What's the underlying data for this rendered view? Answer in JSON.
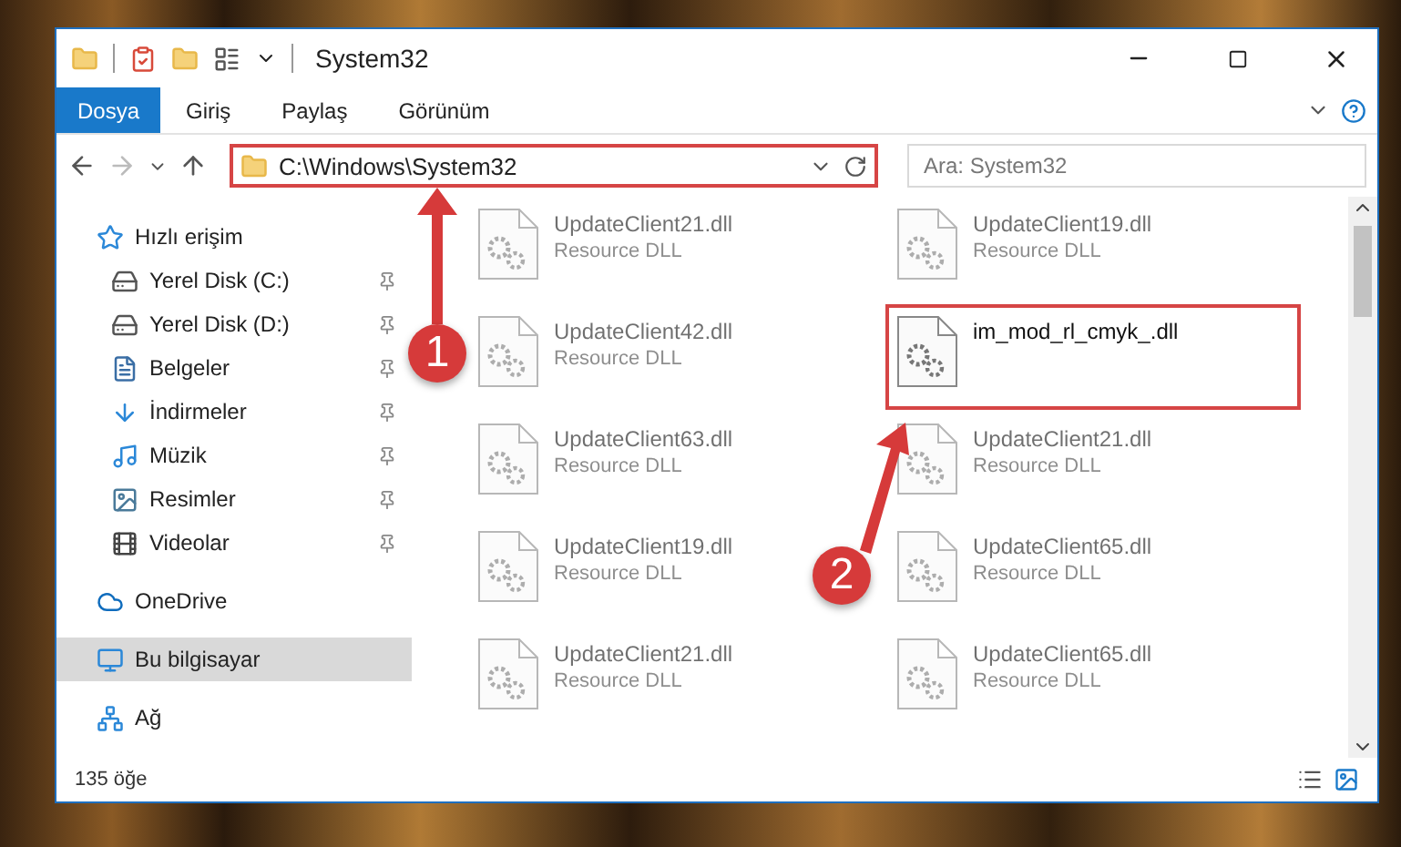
{
  "window": {
    "title": "System32"
  },
  "ribbon": {
    "file_button": "Dosya",
    "tabs": [
      {
        "label": "Giriş",
        "selected": false
      },
      {
        "label": "Paylaş",
        "selected": false
      },
      {
        "label": "Görünüm",
        "selected": false
      }
    ]
  },
  "address": {
    "path": "C:\\Windows\\System32",
    "highlighted": true
  },
  "search": {
    "placeholder": "Ara: System32"
  },
  "sidebar": {
    "items": [
      {
        "label": "Hızlı erişim",
        "kind": "quick",
        "selected": false,
        "children": [
          {
            "label": "Yerel Disk (C:)",
            "kind": "disk_c",
            "pinned": true,
            "selected": false
          },
          {
            "label": "Yerel Disk (D:)",
            "kind": "disk",
            "pinned": true,
            "selected": false
          },
          {
            "label": "Belgeler",
            "kind": "docs",
            "pinned": true,
            "selected": false
          },
          {
            "label": "İndirmeler",
            "kind": "downloads",
            "pinned": true,
            "selected": false
          },
          {
            "label": "Müzik",
            "kind": "music",
            "pinned": true,
            "selected": false
          },
          {
            "label": "Resimler",
            "kind": "pictures",
            "pinned": true,
            "selected": false
          },
          {
            "label": "Videolar",
            "kind": "videos",
            "pinned": true,
            "selected": false
          }
        ]
      },
      {
        "label": "OneDrive",
        "kind": "cloud",
        "selected": false
      },
      {
        "label": "Bu bilgisayar",
        "kind": "pc",
        "selected": true
      },
      {
        "label": "Ağ",
        "kind": "network",
        "selected": false
      }
    ]
  },
  "files": [
    {
      "name": "UpdateClient21.dll",
      "type": "Resource DLL",
      "highlighted": false
    },
    {
      "name": "UpdateClient19.dll",
      "type": "Resource DLL",
      "highlighted": false
    },
    {
      "name": "UpdateClient42.dll",
      "type": "Resource DLL",
      "highlighted": false
    },
    {
      "name": "im_mod_rl_cmyk_.dll",
      "highlighted": true
    },
    {
      "name": "UpdateClient63.dll",
      "type": "Resource DLL",
      "highlighted": false
    },
    {
      "name": "UpdateClient21.dll",
      "type": "Resource DLL",
      "highlighted": false
    },
    {
      "name": "UpdateClient19.dll",
      "type": "Resource DLL",
      "highlighted": false
    },
    {
      "name": "UpdateClient65.dll",
      "type": "Resource DLL",
      "highlighted": false
    },
    {
      "name": "UpdateClient21.dll",
      "type": "Resource DLL",
      "highlighted": false
    },
    {
      "name": "UpdateClient65.dll",
      "type": "Resource DLL",
      "highlighted": false
    }
  ],
  "status_bar": {
    "count": "135 öğe"
  },
  "annotations": [
    {
      "label": "1"
    },
    {
      "label": "2"
    }
  ]
}
